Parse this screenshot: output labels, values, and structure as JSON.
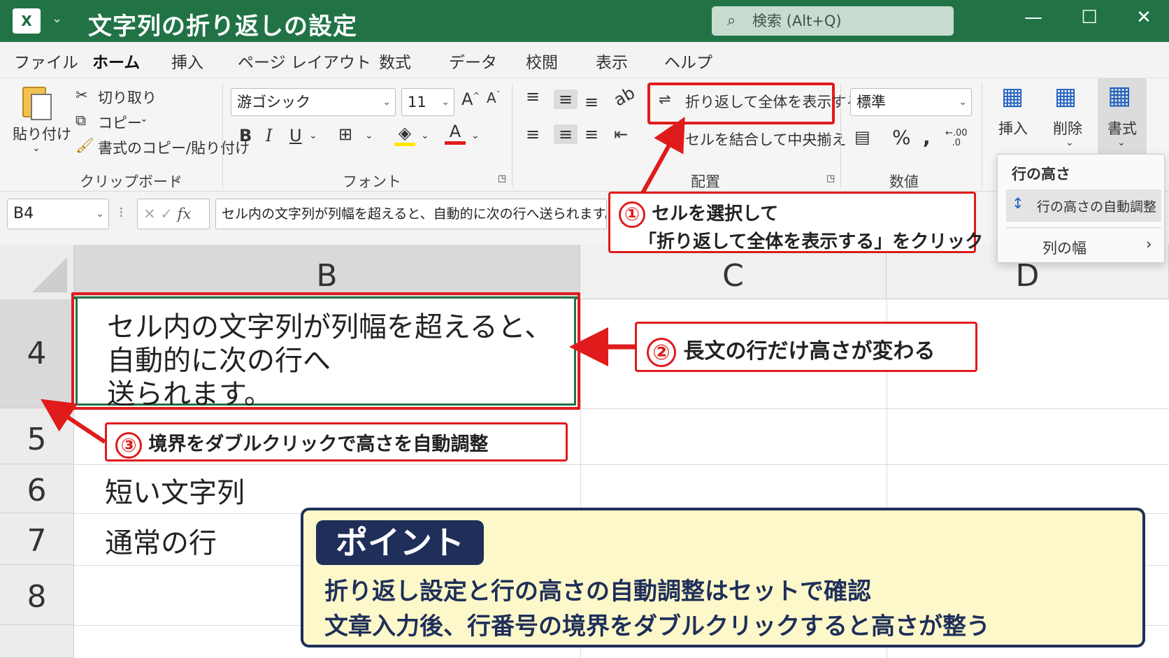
{
  "window": {
    "title": "文字列の折り返しの設定",
    "app_icon": "excel-icon",
    "search_placeholder": "検索 (Alt+Q)",
    "minimize": "—",
    "maximize": "☐",
    "close": "✕"
  },
  "tabs": [
    "ファイル",
    "ホーム",
    "挿入",
    "ページ レイアウト",
    "数式",
    "データ",
    "校閲",
    "表示",
    "ヘルプ"
  ],
  "active_tab": "ホーム",
  "ribbon": {
    "clipboard": {
      "paste": "貼り付け",
      "cut": "切り取り",
      "copy": "コピー",
      "format_painter": "書式のコピー/貼り付け",
      "group": "クリップボード"
    },
    "font": {
      "name": "游ゴシック",
      "size": "11",
      "bold": "B",
      "italic": "I",
      "underline": "U",
      "font_color_letter": "A",
      "group": "フォント"
    },
    "alignment": {
      "wrap_text": "折り返して全体を表示する",
      "merge_center": "セルを結合して中央揃え",
      "group": "配置"
    },
    "number": {
      "format": "標準",
      "percent": "%",
      "comma": ",",
      "decimal": "←.00\n.0",
      "group": "数値"
    },
    "cells": {
      "insert": "挿入",
      "delete": "削除",
      "format": "書式"
    }
  },
  "format_menu": {
    "header": "行の高さ",
    "items": [
      "行の高さの自動調整",
      "列の幅"
    ]
  },
  "formula_bar": {
    "name_box": "B4",
    "fx": "fx",
    "content": "セル内の文字列が列幅を超えると、自動的に次の行へ送られます。"
  },
  "sheet": {
    "columns": [
      "B",
      "C",
      "D"
    ],
    "rows": [
      {
        "num": "4",
        "b": [
          "セル内の文字列が列幅を超えると、",
          "自動的に次の行へ",
          "送られます。"
        ]
      },
      {
        "num": "5",
        "b": []
      },
      {
        "num": "6",
        "b": [
          "短い文字列"
        ]
      },
      {
        "num": "7",
        "b": [
          "通常の行"
        ]
      },
      {
        "num": "8",
        "b": []
      }
    ]
  },
  "callouts": {
    "c1": {
      "num": "①",
      "line1": "セルを選択して",
      "line2": "「折り返して全体を表示する」をクリック"
    },
    "c2": {
      "num": "②",
      "text": "長文の行だけ高さが変わる"
    },
    "c3": {
      "num": "③",
      "text": "境界をダブルクリックで高さを自動調整"
    }
  },
  "point": {
    "title": "ポイント",
    "line1": "折り返し設定と行の高さの自動調整はセットで確認",
    "line2": "文章入力後、行番号の境界をダブルクリックすると高さが整う"
  },
  "colors": {
    "excel_green": "#217346",
    "callout_red": "#e01b1b",
    "point_bg": "#fdf8c9",
    "point_navy": "#1f2f5a"
  }
}
